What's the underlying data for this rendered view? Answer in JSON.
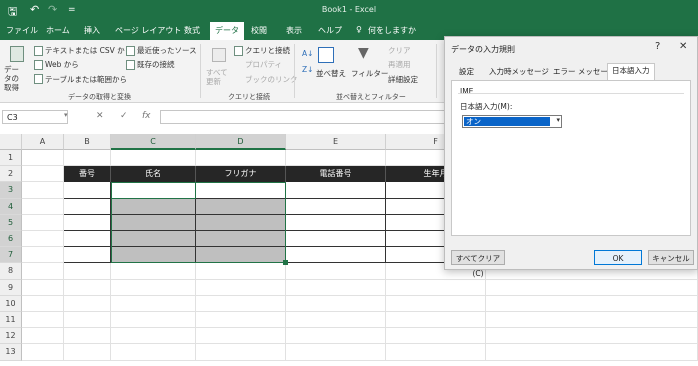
{
  "window": {
    "title": "Book1  -  Excel",
    "quick_access": {
      "save": "🖫",
      "undo": "↶",
      "redo": "↷",
      "customize": "="
    }
  },
  "menu": {
    "tabs": [
      "ファイル",
      "ホーム",
      "挿入",
      "ページ レイアウト",
      "数式",
      "データ",
      "校閲",
      "表示",
      "ヘルプ"
    ],
    "search": "何をしますか"
  },
  "ribbon": {
    "get_data": "データの取得",
    "from_text_csv": "テキストまたは CSV から",
    "from_web": "Web から",
    "from_table": "テーブルまたは範囲から",
    "recent_sources": "最近使ったソース",
    "existing_connections": "既存の接続",
    "group_get_transform": "データの取得と変換",
    "refresh_all": "すべて更新",
    "queries_connections": "クエリと接続",
    "properties": "プロパティ",
    "edit_links": "ブックのリンク",
    "group_queries": "クエリと接続",
    "sort": "並べ替え",
    "filter": "フィルター",
    "clear": "クリア",
    "reapply": "再適用",
    "advanced": "詳細設定",
    "group_sort_filter": "並べ替えとフィルター"
  },
  "formula_bar": {
    "name_box": "C3",
    "fx": "fx",
    "cancel": "✕",
    "enter": "✓",
    "value": ""
  },
  "grid": {
    "columns": [
      "A",
      "B",
      "C",
      "D",
      "E",
      "F"
    ],
    "rows": [
      "1",
      "2",
      "3",
      "4",
      "5",
      "6",
      "7",
      "8",
      "9",
      "10",
      "11",
      "12",
      "13"
    ],
    "table_headers": [
      "番号",
      "氏名",
      "フリガナ",
      "電話番号",
      "生年月"
    ]
  },
  "dialog": {
    "title": "データの入力規則",
    "help": "?",
    "close": "✕",
    "tabs": [
      "設定",
      "入力時メッセージ",
      "エラー メッセージ",
      "日本語入力"
    ],
    "active_tab": "日本語入力",
    "ime_group": "IME",
    "ime_label": "日本語入力(M):",
    "ime_value": "オン",
    "clear_all": "すべてクリア(C)",
    "ok": "OK",
    "cancel": "キャンセル"
  }
}
